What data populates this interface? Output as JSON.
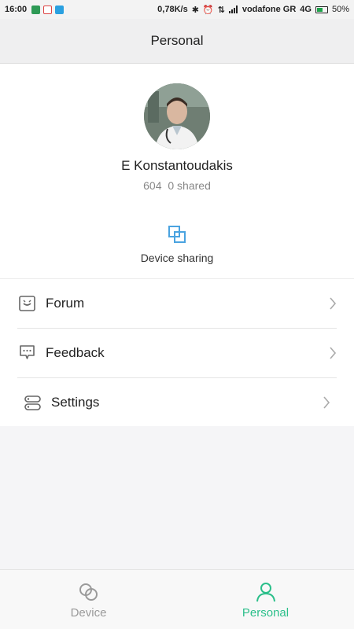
{
  "status_bar": {
    "time": "16:00",
    "net_speed": "0,78K/s",
    "carrier": "vodafone GR",
    "network": "4G",
    "battery": "50%",
    "battery_level": 0.5
  },
  "header": {
    "title": "Personal"
  },
  "profile": {
    "name": "E Konstantoudakis",
    "count": "604",
    "shared": "0 shared",
    "device_sharing_label": "Device sharing"
  },
  "menu": {
    "items": [
      {
        "label": "Forum",
        "icon": "smiley-box-icon"
      },
      {
        "label": "Feedback",
        "icon": "chat-bubble-icon"
      },
      {
        "label": "Settings",
        "icon": "toggles-icon"
      }
    ]
  },
  "bottom_nav": {
    "items": [
      {
        "label": "Device",
        "icon": "link-rings-icon",
        "active": false
      },
      {
        "label": "Personal",
        "icon": "person-icon",
        "active": true
      }
    ]
  },
  "colors": {
    "accent": "#2bbf8a",
    "share_icon": "#4aa3e0",
    "inactive": "#9a9a9a"
  }
}
